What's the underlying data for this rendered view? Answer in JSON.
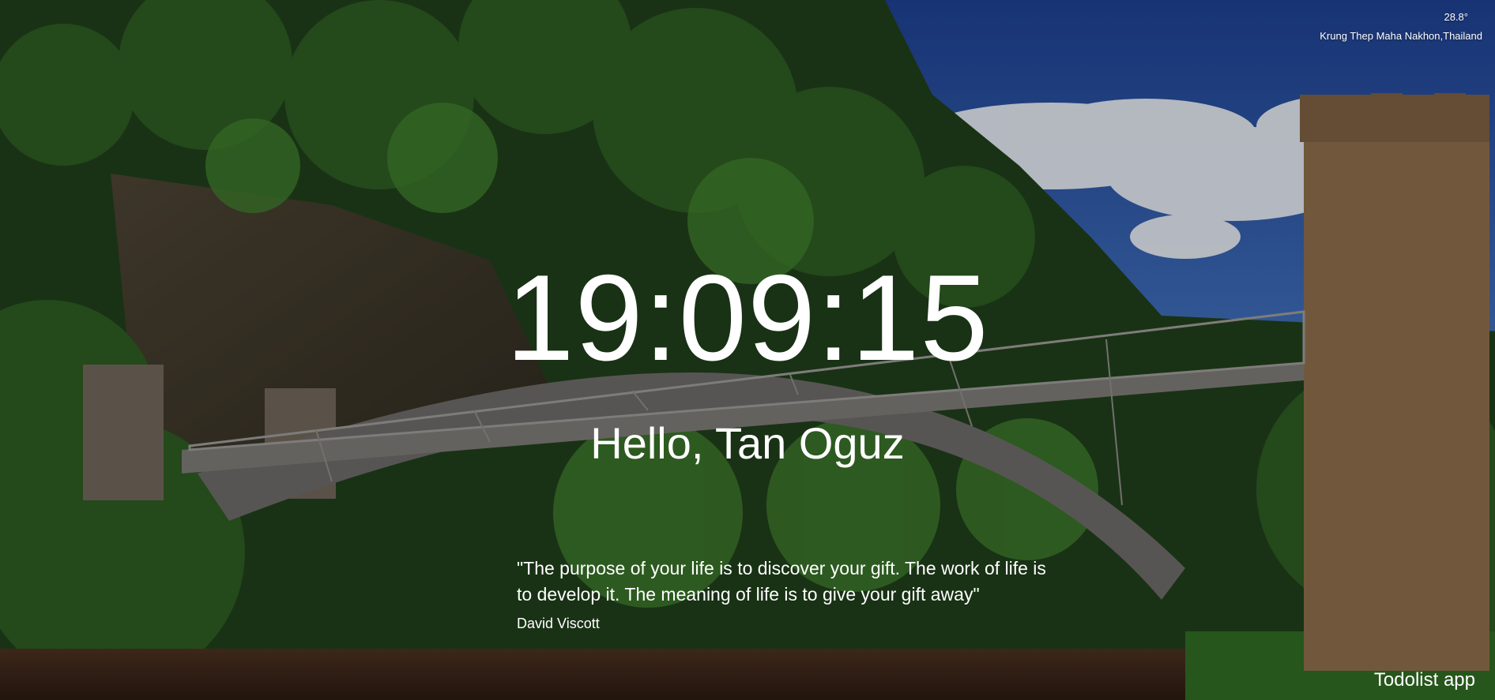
{
  "weather": {
    "temperature": "28.8°",
    "location": "Krung Thep Maha Nakhon,Thailand"
  },
  "clock": {
    "time": "19:09:15"
  },
  "greeting": {
    "text": "Hello, Tan Oguz"
  },
  "quote": {
    "text": "\"The purpose of your life is to discover your gift. The work of life is to develop it. The meaning of life is to give your gift away\"",
    "author": "David Viscott"
  },
  "footer": {
    "todolist_label": "Todolist app"
  }
}
